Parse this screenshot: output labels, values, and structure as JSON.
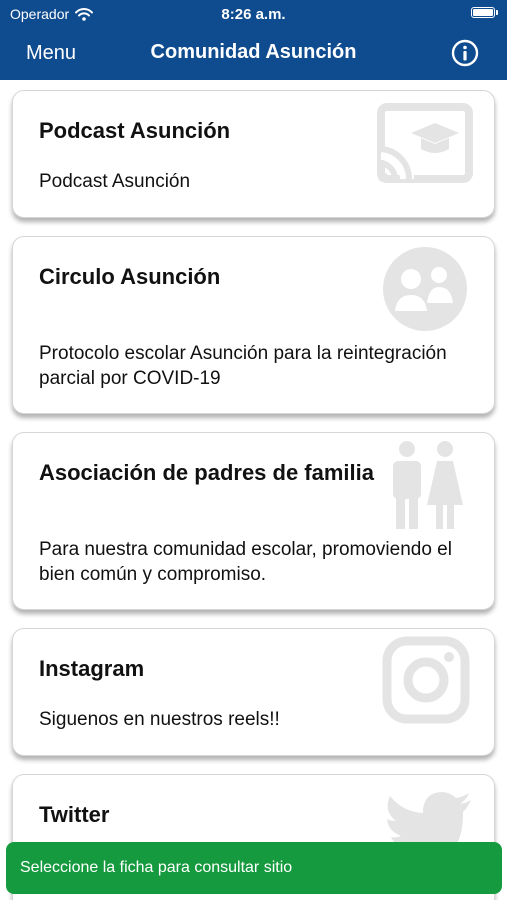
{
  "status_bar": {
    "carrier": "Operador",
    "time": "8:26 a.m."
  },
  "nav": {
    "menu_label": "Menu",
    "title": "Comunidad Asunción"
  },
  "cards": [
    {
      "title": "Podcast Asunción",
      "description": "Podcast Asunción",
      "icon": "cast-graduation-icon"
    },
    {
      "title": "Circulo Asunción",
      "description": "Protocolo escolar Asunción para la reintegración parcial por COVID-19",
      "icon": "community-circle-icon"
    },
    {
      "title": "Asociación de padres de familia",
      "description": "Para nuestra comunidad escolar, promoviendo el bien común y compromiso.",
      "icon": "parents-icon"
    },
    {
      "title": "Instagram",
      "description": "Siguenos en nuestros reels!!",
      "icon": "instagram-icon"
    },
    {
      "title": "Twitter",
      "description": "",
      "icon": "twitter-icon"
    }
  ],
  "toast": {
    "message": "Seleccione la ficha para consultar sitio"
  },
  "colors": {
    "header": "#0e4b8f",
    "toast": "#169a3f",
    "icon_watermark": "#e4e4e4"
  }
}
